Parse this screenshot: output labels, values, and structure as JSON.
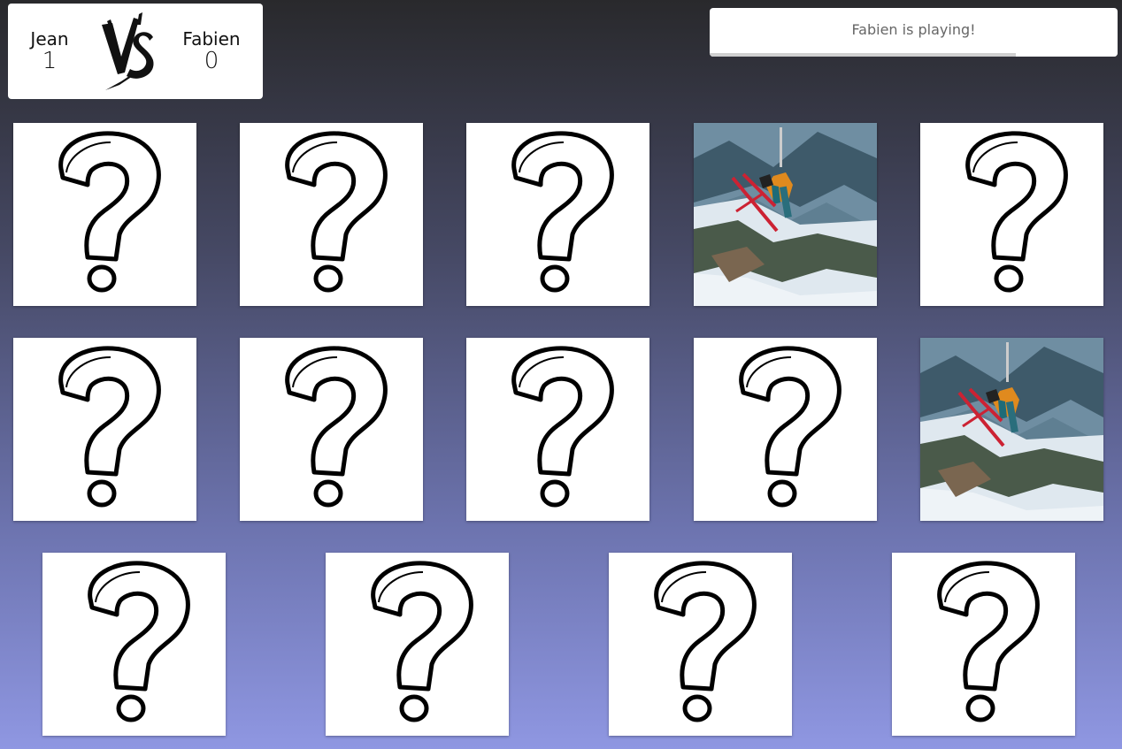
{
  "scoreboard": {
    "player1": {
      "name": "Jean",
      "score": "1"
    },
    "player2": {
      "name": "Fabien",
      "score": "0"
    },
    "vs_icon": "vs-brush-logo"
  },
  "status": {
    "message": "Fabien is playing!",
    "timer_progress": 0.75
  },
  "board": {
    "card_back_icon": "question-mark-icon",
    "cards": [
      {
        "state": "hidden"
      },
      {
        "state": "hidden"
      },
      {
        "state": "hidden"
      },
      {
        "state": "revealed",
        "image": "skier-jump-photo"
      },
      {
        "state": "hidden"
      },
      {
        "state": "hidden"
      },
      {
        "state": "hidden"
      },
      {
        "state": "hidden"
      },
      {
        "state": "hidden"
      },
      {
        "state": "revealed",
        "image": "skier-jump-photo"
      },
      {
        "state": "hidden"
      },
      {
        "state": "hidden"
      },
      {
        "state": "hidden"
      },
      {
        "state": "hidden"
      }
    ]
  }
}
